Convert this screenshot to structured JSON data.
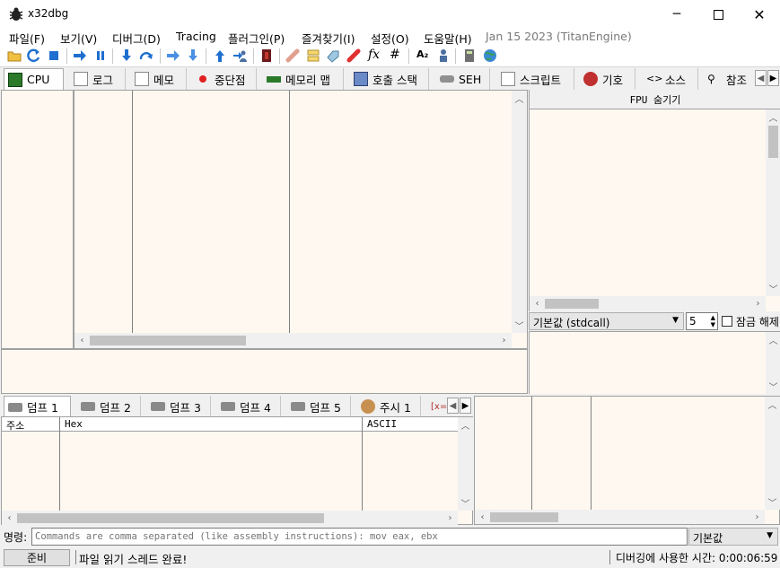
{
  "window": {
    "title": "x32dbg"
  },
  "menu": [
    {
      "id": "file",
      "label": "파일(F)"
    },
    {
      "id": "view",
      "label": "보기(V)"
    },
    {
      "id": "debug",
      "label": "디버그(D)"
    },
    {
      "id": "tracing",
      "label": "Tracing"
    },
    {
      "id": "plugins",
      "label": "플러그인(P)"
    },
    {
      "id": "favourites",
      "label": "즐겨찾기(I)"
    },
    {
      "id": "settings",
      "label": "설정(O)"
    },
    {
      "id": "help",
      "label": "도움말(H)"
    }
  ],
  "build_info": "Jan 15 2023 (TitanEngine)",
  "main_tabs": [
    {
      "id": "cpu",
      "label": "CPU"
    },
    {
      "id": "log",
      "label": "로그"
    },
    {
      "id": "notes",
      "label": "메모"
    },
    {
      "id": "breakpoints",
      "label": "중단점"
    },
    {
      "id": "memory-map",
      "label": "메모리 맵"
    },
    {
      "id": "call-stack",
      "label": "호출 스택"
    },
    {
      "id": "seh",
      "label": "SEH"
    },
    {
      "id": "script",
      "label": "스크립트"
    },
    {
      "id": "symbols",
      "label": "기호"
    },
    {
      "id": "source",
      "label": "소스"
    },
    {
      "id": "references",
      "label": "참조"
    }
  ],
  "fpu": {
    "hide_label": "FPU 숨기기",
    "calling_convention": "기본값 (stdcall)",
    "arg_count": "5",
    "lock_label": "잠금 해제"
  },
  "dump_tabs": [
    {
      "id": "dump1",
      "label": "덤프 1"
    },
    {
      "id": "dump2",
      "label": "덤프 2"
    },
    {
      "id": "dump3",
      "label": "덤프 3"
    },
    {
      "id": "dump4",
      "label": "덤프 4"
    },
    {
      "id": "dump5",
      "label": "덤프 5"
    },
    {
      "id": "watch1",
      "label": "주시 1"
    },
    {
      "id": "locals",
      "label": "[x="
    }
  ],
  "dump_headers": {
    "address": "주소",
    "hex": "Hex",
    "ascii": "ASCII"
  },
  "command": {
    "label": "명령:",
    "placeholder": "Commands are comma separated (like assembly instructions): mov eax, ebx",
    "mode": "기본값"
  },
  "status": {
    "state": "준비",
    "message": "파일 읽기 스레드 완료!",
    "time_label": "디버깅에 사용한 시간: 0:00:06:59"
  },
  "colors": {
    "pane_bg": "#fff8f0",
    "accent_blue": "#1f6fd0"
  }
}
